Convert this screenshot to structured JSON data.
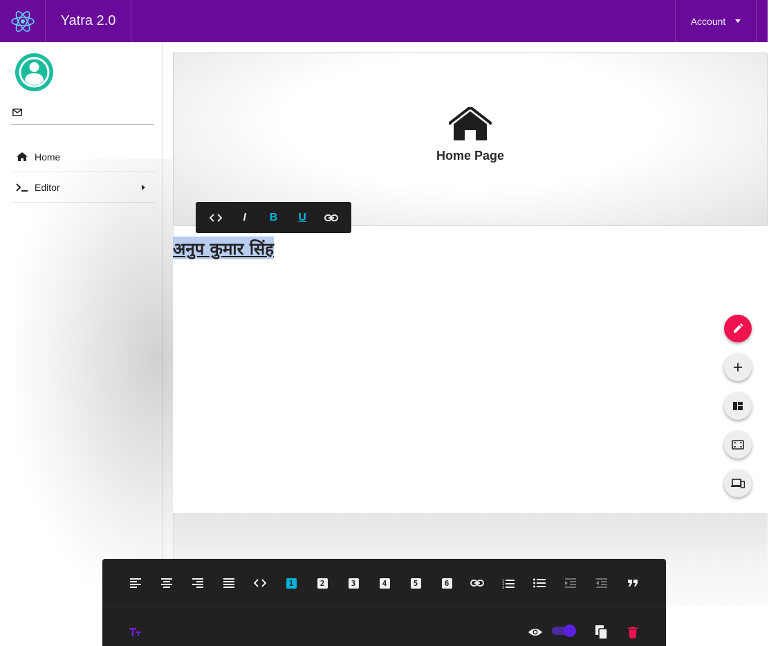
{
  "app": {
    "title": "Yatra 2.0",
    "account_label": "Account",
    "brand_color": "#6a0a9b"
  },
  "sidebar": {
    "email": "",
    "items": [
      {
        "label": "Home",
        "icon": "home-icon"
      },
      {
        "label": "Editor",
        "icon": "terminal-icon",
        "has_submenu": true
      }
    ]
  },
  "hero": {
    "title": "Home Page",
    "icon": "home-icon"
  },
  "editor": {
    "selected_text": "अनुप कुमार सिंह"
  },
  "inline_toolbar": {
    "buttons": [
      {
        "name": "code",
        "icon": "code-icon"
      },
      {
        "name": "italic",
        "label": "I"
      },
      {
        "name": "bold",
        "label": "B",
        "active": true
      },
      {
        "name": "underline",
        "label": "U",
        "active": true
      },
      {
        "name": "link",
        "icon": "link-icon"
      }
    ]
  },
  "fabs": [
    {
      "name": "edit",
      "icon": "pencil-icon",
      "color": "#f0134f"
    },
    {
      "name": "add",
      "icon": "plus-icon"
    },
    {
      "name": "layout",
      "icon": "dashboard-icon"
    },
    {
      "name": "fullscreen",
      "icon": "fit-screen-icon"
    },
    {
      "name": "devices",
      "icon": "devices-icon"
    }
  ],
  "bottom_toolbar": {
    "headings": [
      "1",
      "2",
      "3",
      "4",
      "5",
      "6"
    ],
    "active_heading": "1",
    "accent_color": "#00b4d8",
    "preview_toggle_on": true
  }
}
